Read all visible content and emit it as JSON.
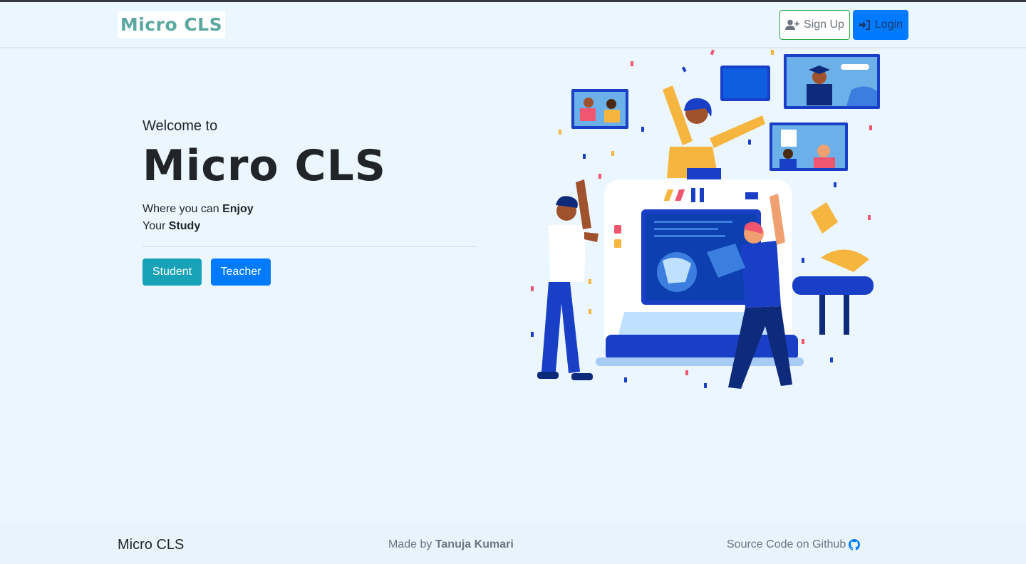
{
  "navbar": {
    "brand": "Micro CLS",
    "signup_label": "Sign Up",
    "login_label": "Login",
    "signup_icon": "user-plus-icon",
    "login_icon": "sign-in-icon"
  },
  "hero": {
    "welcome": "Welcome to",
    "title": "Micro CLS",
    "line1_prefix": "Where you can ",
    "line1_bold": "Enjoy",
    "line2_prefix": "Your ",
    "line2_bold": "Study",
    "student_label": "Student",
    "teacher_label": "Teacher"
  },
  "footer": {
    "brand": "Micro CLS",
    "made_prefix": "Made by ",
    "author": "Tanuja Kumari",
    "source_label": "Source Code on Github",
    "source_icon": "github-icon"
  },
  "colors": {
    "background": "#ebf6fe",
    "primary": "#007bff",
    "info": "#17a2b8",
    "success": "#28a745",
    "brand_text": "#5ba8a0"
  }
}
